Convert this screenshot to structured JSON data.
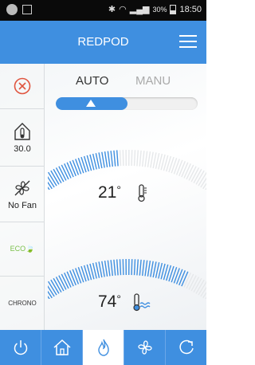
{
  "status_bar": {
    "signal_percent": "30%",
    "time": "18:50"
  },
  "header": {
    "title": "REDPOD"
  },
  "sidebar": {
    "temperature_reading": "30.0",
    "fan_label": "No Fan",
    "eco_label": "ECO",
    "chrono_label": "CHRONO"
  },
  "mode": {
    "auto_label": "AUTO",
    "manu_label": "MANU",
    "selected": "AUTO"
  },
  "temperature": {
    "value": "21",
    "unit": "°"
  },
  "humidity": {
    "value": "74",
    "unit": "°"
  },
  "bottom_nav": {
    "items": [
      "power-icon",
      "home-icon",
      "flame-icon",
      "fan-icon",
      "refresh-icon"
    ],
    "active_index": 2
  },
  "colors": {
    "accent": "#3f8fe0",
    "off_red": "#e0553f",
    "eco_green": "#7ac04a"
  }
}
